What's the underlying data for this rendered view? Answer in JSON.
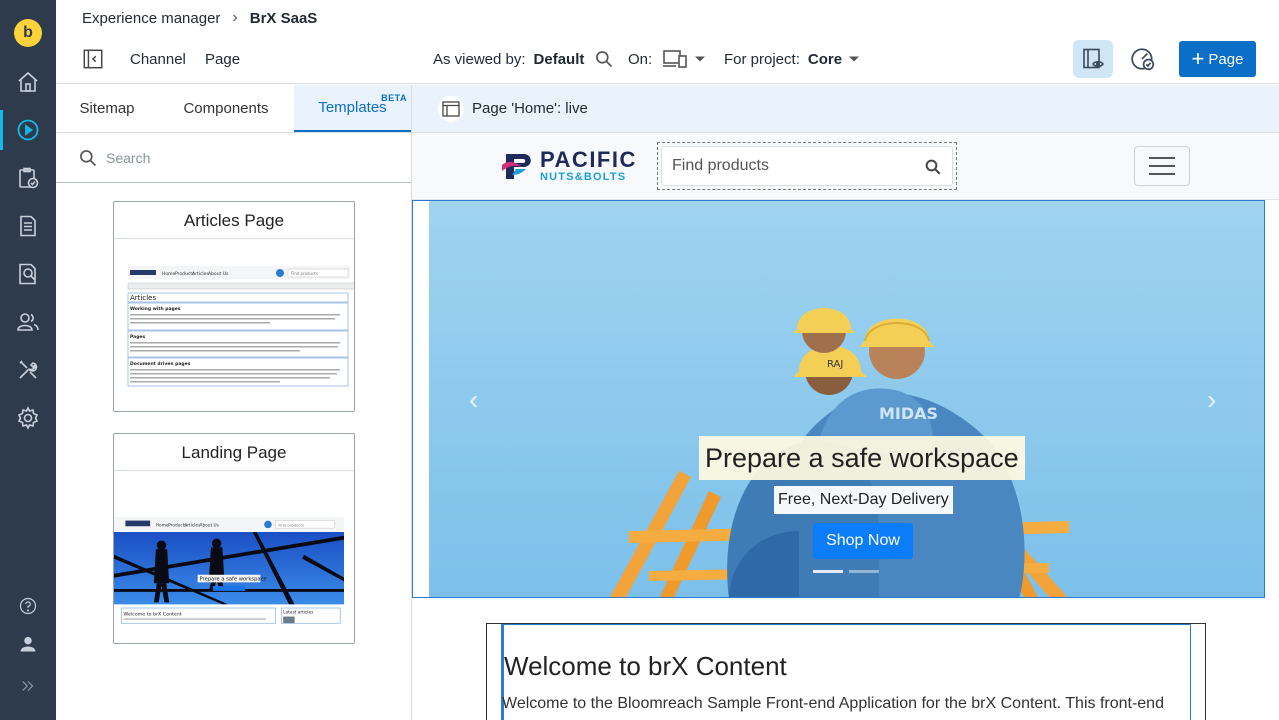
{
  "app": {
    "logo_letter": "b"
  },
  "breadcrumb": {
    "root": "Experience manager",
    "current": "BrX SaaS"
  },
  "toolbar": {
    "channel_label": "Channel",
    "page_label": "Page",
    "viewed_by_label": "As viewed by:",
    "viewed_by_value": "Default",
    "on_label": "On:",
    "project_label": "For project:",
    "project_value": "Core",
    "add_page_label": "Page"
  },
  "panel": {
    "tabs": [
      {
        "label": "Sitemap"
      },
      {
        "label": "Components"
      },
      {
        "label": "Templates",
        "badge": "BETA",
        "active": true
      }
    ],
    "search_placeholder": "Search",
    "templates": [
      {
        "title": "Articles Page"
      },
      {
        "title": "Landing Page"
      }
    ],
    "thumb_articles": {
      "nav": [
        "Home",
        "Products",
        "Articles",
        "About Us"
      ],
      "search": "Find products",
      "heading": "Articles",
      "sections": [
        "Working with pages",
        "Pages",
        "Document driven pages"
      ]
    },
    "thumb_landing": {
      "nav": [
        "Home",
        "Products",
        "Articles",
        "About Us"
      ],
      "search": "Find products",
      "caption": "Prepare a safe workspace",
      "welcome": "Welcome to brX Content",
      "latest": "Latest articles"
    }
  },
  "preview": {
    "page_status": "Page 'Home': live",
    "brand_top": "PACIFIC",
    "brand_bottom": "NUTS&BOLTS",
    "search_placeholder": "Find products",
    "hero": {
      "title": "Prepare a safe workspace",
      "subtitle": "Free, Next-Day Delivery",
      "button": "Shop Now",
      "helmet_texts": [
        "RAJ",
        "MIDAS"
      ]
    },
    "welcome_title": "Welcome to brX Content",
    "welcome_text": "Welcome to the Bloomreach Sample Front-end Application for the brX Content. This front-end"
  },
  "colors": {
    "rail_bg": "#2e3b4d",
    "accent": "#0b6ec7",
    "logo_yellow": "#fdd33b",
    "rail_active": "#16b6e8",
    "shop_button": "#0b7dfb",
    "hero_sky": "#8ecbed"
  },
  "icons": {
    "rail": [
      "home-icon",
      "experience-manager-icon",
      "projects-icon",
      "content-icon",
      "content-search-icon",
      "audiences-icon",
      "admin-tools-icon",
      "settings-icon",
      "help-icon",
      "user-icon",
      "expand-icon"
    ]
  }
}
